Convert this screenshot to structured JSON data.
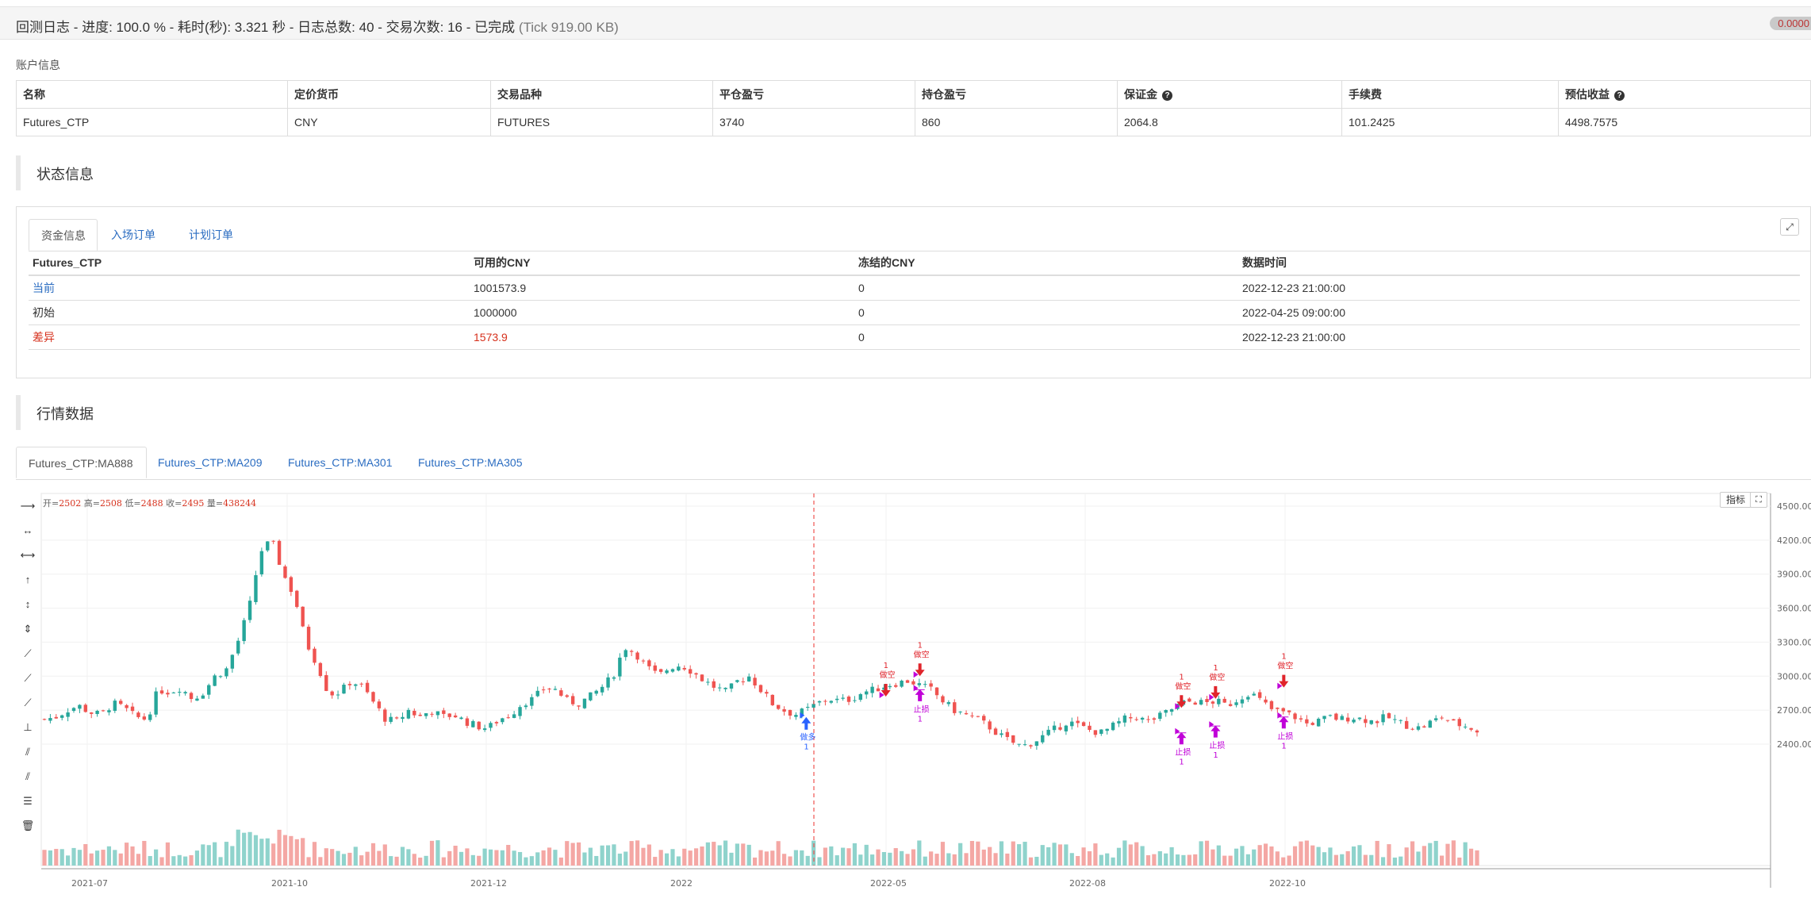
{
  "header": {
    "title": "回测日志 - 进度: 100.0 % - 耗时(秒): 3.321 秒 - 日志总数: 40 - 交易次数: 16 - 已完成",
    "tick": "(Tick 919.00 KB)",
    "badge": "0.0000"
  },
  "account": {
    "section_label": "账户信息",
    "columns": [
      "名称",
      "定价货币",
      "交易品种",
      "平仓盈亏",
      "持仓盈亏",
      "保证金",
      "手续费",
      "预估收益"
    ],
    "help_icon_columns": [
      5,
      7
    ],
    "row": [
      "Futures_CTP",
      "CNY",
      "FUTURES",
      "3740",
      "860",
      "2064.8",
      "101.2425",
      "4498.7575"
    ]
  },
  "status": {
    "title": "状态信息",
    "tabs": [
      "资金信息",
      "入场订单",
      "计划订单"
    ],
    "active_tab": 0,
    "table": {
      "columns": [
        "Futures_CTP",
        "可用的CNY",
        "冻结的CNY",
        "数据时间"
      ],
      "rows": [
        [
          "当前",
          "1001573.9",
          "0",
          "2022-12-23 21:00:00"
        ],
        [
          "初始",
          "1000000",
          "0",
          "2022-04-25 09:00:00"
        ],
        [
          "差异",
          "1573.9",
          "0",
          "2022-12-23 21:00:00"
        ]
      ]
    }
  },
  "market": {
    "title": "行情数据",
    "tabs": [
      "Futures_CTP:MA888",
      "Futures_CTP:MA209",
      "Futures_CTP:MA301",
      "Futures_CTP:MA305"
    ],
    "active_tab": 0,
    "ohlc": {
      "open_label": "开=",
      "open": "2502",
      "high_label": "高=",
      "high": "2508",
      "low_label": "低=",
      "low": "2488",
      "close_label": "收=",
      "close": "2495",
      "vol_label": "量=",
      "vol": "438244"
    },
    "indicator_button": "指标"
  },
  "colors": {
    "up": "#26a69a",
    "down": "#ef5350",
    "buy": "#2962ff",
    "sell": "#e0242b",
    "stop": "#c000d8"
  },
  "chart_data": {
    "type": "candlestick",
    "y_ticks": [
      "4500.00",
      "4200.00",
      "3900.00",
      "3600.00",
      "3300.00",
      "3000.00",
      "2700.00",
      "2400.00"
    ],
    "ylim": [
      2280,
      4530
    ],
    "x_ticks": [
      "2021-07",
      "2021-10",
      "2021-12",
      "2022",
      "2022-05",
      "2022-08",
      "2022-10"
    ],
    "close_path": [
      2620,
      2640,
      2700,
      2740,
      2680,
      2660,
      2760,
      2720,
      2640,
      2620,
      2880,
      2860,
      2900,
      2800,
      2860,
      3000,
      3060,
      3300,
      3600,
      4100,
      4200,
      3900,
      3700,
      3300,
      3100,
      2840,
      2860,
      2960,
      2900,
      2760,
      2620,
      2600,
      2700,
      2640,
      2700,
      2640,
      2660,
      2600,
      2560,
      2540,
      2620,
      2660,
      2760,
      2800,
      2900,
      2880,
      2780,
      2760,
      2820,
      2900,
      3000,
      3260,
      3200,
      3080,
      3000,
      3080,
      3100,
      3040,
      2960,
      2900,
      2860,
      2960,
      3000,
      2880,
      2760,
      2700,
      2660,
      2700,
      2760,
      2800,
      2780,
      2800,
      2860,
      2880,
      2920,
      2940,
      2960,
      2920,
      2880,
      2780,
      2700,
      2660,
      2620,
      2560,
      2480,
      2420,
      2380,
      2420,
      2480,
      2540,
      2600,
      2560,
      2520,
      2500,
      2560,
      2620,
      2640,
      2600,
      2640,
      2700,
      2760,
      2780,
      2760,
      2780,
      2740,
      2800,
      2860,
      2780,
      2700,
      2680,
      2640,
      2580,
      2600,
      2640,
      2620,
      2640,
      2620,
      2600,
      2640,
      2600,
      2560,
      2540,
      2600,
      2640,
      2580,
      2560,
      2520
    ],
    "trade_markers": [
      {
        "type": "做多",
        "qty": "1",
        "bar": 67,
        "price": 2640
      },
      {
        "type": "做空",
        "qty": "1",
        "bar": 74,
        "price": 2820
      },
      {
        "type": "做空",
        "qty": "1",
        "bar": 77,
        "price": 3000
      },
      {
        "type": "止损",
        "qty": "1",
        "bar": 77,
        "price": 2880
      },
      {
        "type": "做空",
        "qty": "1",
        "bar": 100,
        "price": 2720
      },
      {
        "type": "止损",
        "qty": "1",
        "bar": 100,
        "price": 2500
      },
      {
        "type": "做空",
        "qty": "1",
        "bar": 103,
        "price": 2800
      },
      {
        "type": "止损",
        "qty": "1",
        "bar": 103,
        "price": 2560
      },
      {
        "type": "做空",
        "qty": "1",
        "bar": 109,
        "price": 2900
      },
      {
        "type": "止损",
        "qty": "1",
        "bar": 109,
        "price": 2640
      }
    ]
  }
}
